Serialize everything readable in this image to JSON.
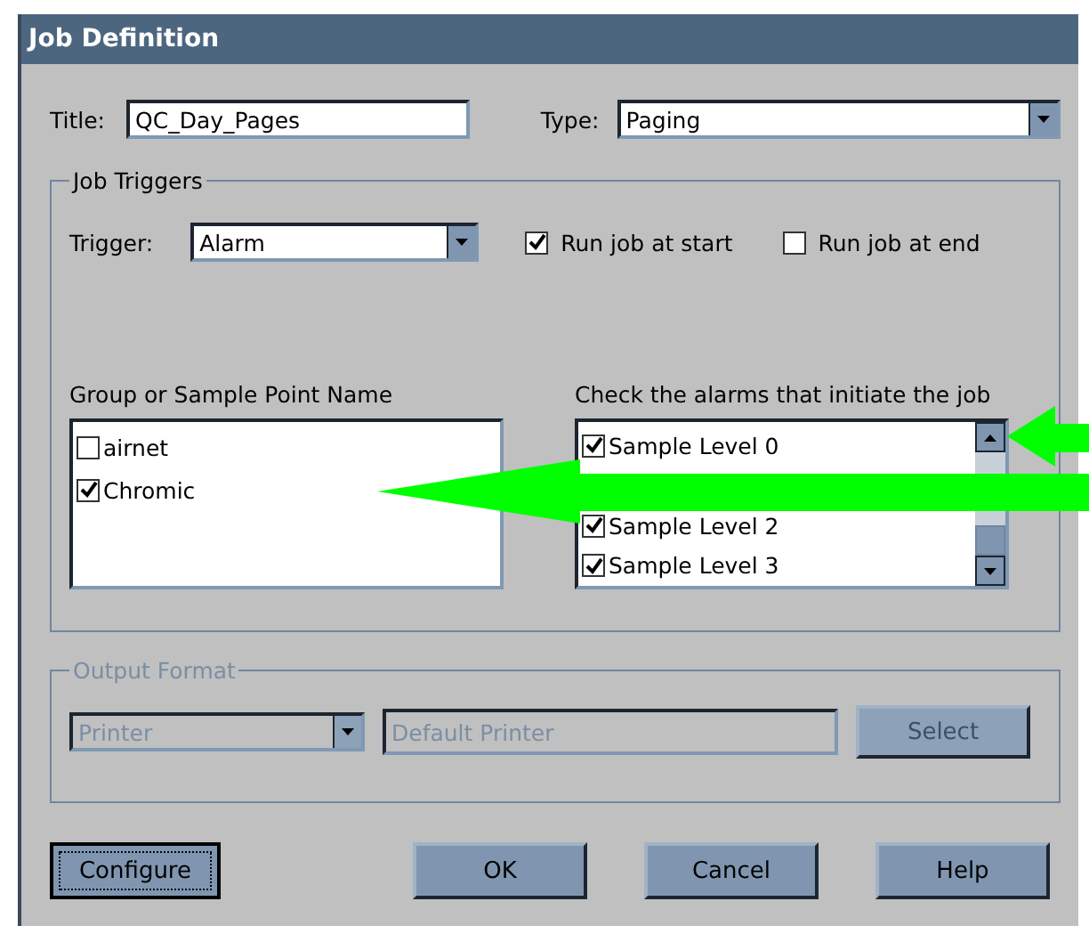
{
  "window": {
    "title": "Job Definition"
  },
  "title_field": {
    "label": "Title:",
    "value": "QC_Day_Pages"
  },
  "type_field": {
    "label": "Type:",
    "value": "Paging"
  },
  "job_triggers": {
    "legend": "Job Triggers",
    "trigger": {
      "label": "Trigger:",
      "value": "Alarm"
    },
    "options": [
      {
        "label": "Run job at start",
        "checked": true
      },
      {
        "label": "Run job at end",
        "checked": false
      }
    ],
    "groups": {
      "heading": "Group or Sample Point Name",
      "items": [
        {
          "label": "airnet",
          "checked": false
        },
        {
          "label": "Chromic",
          "checked": true
        }
      ]
    },
    "alarms": {
      "heading": "Check the alarms that initiate the job",
      "items": [
        {
          "label": "Sample Level 0",
          "checked": true
        },
        {
          "covered": true
        },
        {
          "label": "Sample Level 2",
          "checked": true
        },
        {
          "label": "Sample Level 3",
          "checked": true
        }
      ]
    }
  },
  "output_format": {
    "legend": "Output Format",
    "disabled": true,
    "device": "Printer",
    "target": "Default Printer",
    "select_button": "Select"
  },
  "buttons": [
    {
      "label": "Configure",
      "focused": true
    },
    {
      "label": "OK",
      "focused": false
    },
    {
      "label": "Cancel",
      "focused": false
    },
    {
      "label": "Help",
      "focused": false
    }
  ]
}
